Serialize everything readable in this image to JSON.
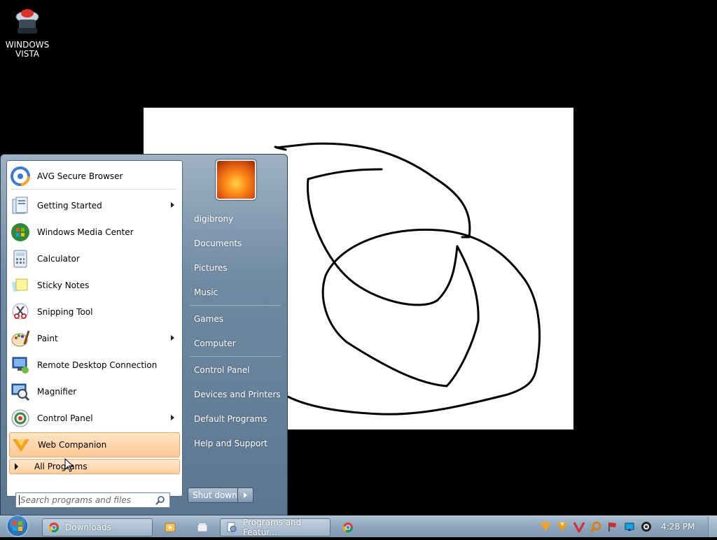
{
  "desktop": {
    "icons": [
      {
        "label": "WINDOWS VISTA",
        "icon": "windows-vista-icon"
      }
    ]
  },
  "start_menu": {
    "pinned": [
      {
        "label": "AVG Secure Browser",
        "icon": "avg-browser-icon"
      }
    ],
    "recent": [
      {
        "label": "Getting Started",
        "icon": "getting-started-icon",
        "submenu": true
      },
      {
        "label": "Windows Media Center",
        "icon": "media-center-icon",
        "submenu": false
      },
      {
        "label": "Calculator",
        "icon": "calculator-icon",
        "submenu": false
      },
      {
        "label": "Sticky Notes",
        "icon": "sticky-notes-icon",
        "submenu": false
      },
      {
        "label": "Snipping Tool",
        "icon": "snipping-tool-icon",
        "submenu": false
      },
      {
        "label": "Paint",
        "icon": "paint-icon",
        "submenu": true
      },
      {
        "label": "Remote Desktop Connection",
        "icon": "remote-desktop-icon",
        "submenu": false
      },
      {
        "label": "Magnifier",
        "icon": "magnifier-icon",
        "submenu": false
      },
      {
        "label": "Control Panel",
        "icon": "control-panel-icon",
        "submenu": true
      },
      {
        "label": "Web Companion",
        "icon": "web-companion-icon",
        "submenu": false,
        "highlighted": true
      }
    ],
    "all_programs": "All Programs",
    "search_placeholder": "Search programs and files",
    "right_items": [
      {
        "label": "digibrony"
      },
      {
        "label": "Documents"
      },
      {
        "label": "Pictures"
      },
      {
        "label": "Music"
      },
      {
        "label": "Games"
      },
      {
        "label": "Computer"
      },
      {
        "label": "Control Panel"
      },
      {
        "label": "Devices and Printers"
      },
      {
        "label": "Default Programs"
      },
      {
        "label": "Help and Support"
      }
    ],
    "shutdown_label": "Shut down"
  },
  "taskbar": {
    "buttons": [
      {
        "label": "Downloads",
        "icon": "chrome-icon"
      },
      {
        "label": "Programs and Featur...",
        "icon": "programs-features-icon"
      }
    ],
    "clock": "4:28 PM"
  },
  "colors": {
    "highlight": "#ffc996",
    "start_menu_blue": "#6f8aa3",
    "taskbar": "#8ea7be"
  }
}
